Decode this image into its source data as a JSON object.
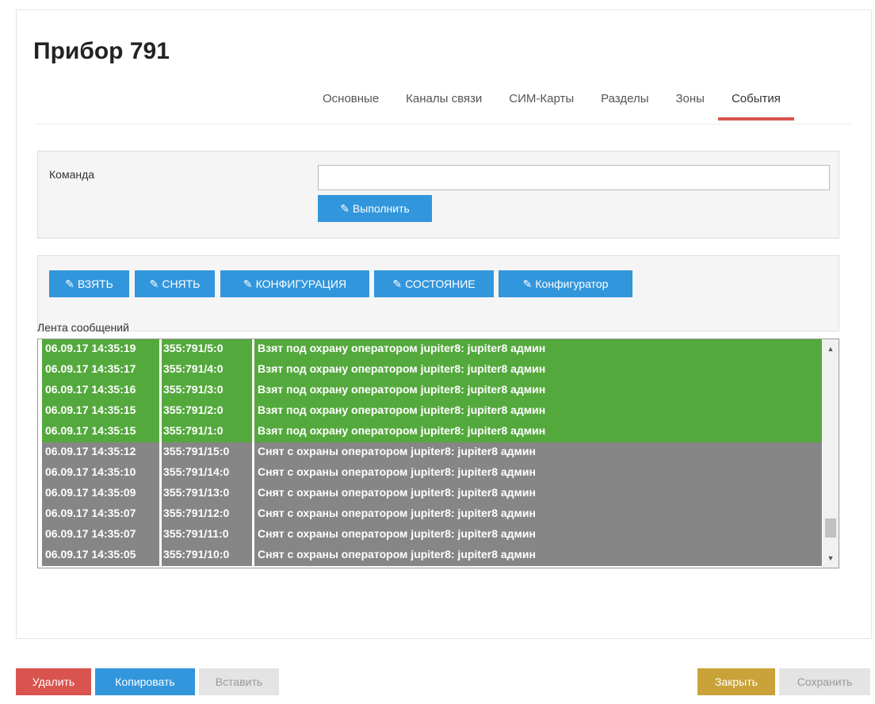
{
  "page": {
    "title": "Прибор 791"
  },
  "tabs": [
    {
      "label": "Основные",
      "active": false
    },
    {
      "label": "Каналы связи",
      "active": false
    },
    {
      "label": "СИМ-Карты",
      "active": false
    },
    {
      "label": "Разделы",
      "active": false
    },
    {
      "label": "Зоны",
      "active": false
    },
    {
      "label": "События",
      "active": true
    }
  ],
  "command": {
    "label": "Команда",
    "input_value": "",
    "placeholder": "",
    "execute_label": "Выполнить"
  },
  "actions": [
    {
      "label": "ВЗЯТЬ"
    },
    {
      "label": "СНЯТЬ"
    },
    {
      "label": "КОНФИГУРАЦИЯ"
    },
    {
      "label": "СОСТОЯНИЕ"
    },
    {
      "label": "Конфигуратор"
    }
  ],
  "feed": {
    "label": "Лента сообщений",
    "rows": [
      {
        "time": "06.09.17 14:35:19",
        "id": "355:791/5:0",
        "message": "Взят под охрану оператором jupiter8: jupiter8 админ",
        "status": "green"
      },
      {
        "time": "06.09.17 14:35:17",
        "id": "355:791/4:0",
        "message": "Взят под охрану оператором jupiter8: jupiter8 админ",
        "status": "green"
      },
      {
        "time": "06.09.17 14:35:16",
        "id": "355:791/3:0",
        "message": "Взят под охрану оператором jupiter8: jupiter8 админ",
        "status": "green"
      },
      {
        "time": "06.09.17 14:35:15",
        "id": "355:791/2:0",
        "message": "Взят под охрану оператором jupiter8: jupiter8 админ",
        "status": "green"
      },
      {
        "time": "06.09.17 14:35:15",
        "id": "355:791/1:0",
        "message": "Взят под охрану оператором jupiter8: jupiter8 админ",
        "status": "green"
      },
      {
        "time": "06.09.17 14:35:12",
        "id": "355:791/15:0",
        "message": "Снят с охраны оператором jupiter8: jupiter8 админ",
        "status": "gray"
      },
      {
        "time": "06.09.17 14:35:10",
        "id": "355:791/14:0",
        "message": "Снят с охраны оператором jupiter8: jupiter8 админ",
        "status": "gray"
      },
      {
        "time": "06.09.17 14:35:09",
        "id": "355:791/13:0",
        "message": "Снят с охраны оператором jupiter8: jupiter8 админ",
        "status": "gray"
      },
      {
        "time": "06.09.17 14:35:07",
        "id": "355:791/12:0",
        "message": "Снят с охраны оператором jupiter8: jupiter8 админ",
        "status": "gray"
      },
      {
        "time": "06.09.17 14:35:07",
        "id": "355:791/11:0",
        "message": "Снят с охраны оператором jupiter8: jupiter8 админ",
        "status": "gray"
      },
      {
        "time": "06.09.17 14:35:05",
        "id": "355:791/10:0",
        "message": "Снят с охраны оператором jupiter8: jupiter8 админ",
        "status": "gray"
      }
    ]
  },
  "footer": {
    "delete_label": "Удалить",
    "copy_label": "Копировать",
    "paste_label": "Вставить",
    "close_label": "Закрыть",
    "save_label": "Сохранить"
  },
  "colors": {
    "armed_row": "#54a93d",
    "disarmed_row": "#868686",
    "primary_button": "#3296dc",
    "danger_button": "#d9534f",
    "close_button": "#c9a239",
    "active_tab_underline": "#d9534f"
  },
  "icons": {
    "action_button_icon": "edit-icon",
    "scroll_up": "scroll-up-arrow-icon",
    "scroll_down": "scroll-down-arrow-icon"
  }
}
